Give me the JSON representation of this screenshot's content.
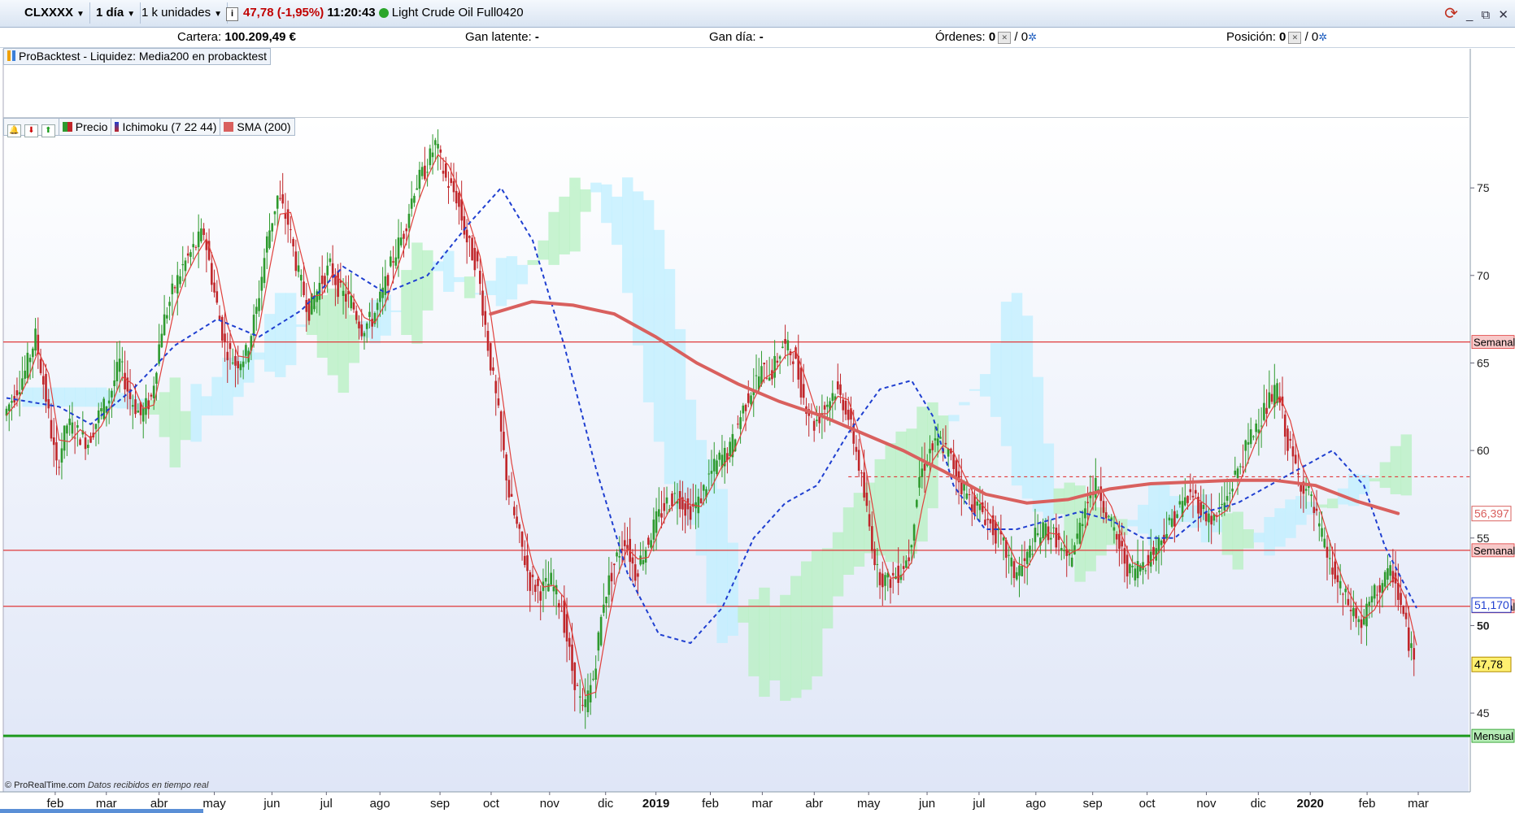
{
  "toolbar": {
    "symbol": "CLXXXX",
    "timeframe": "1 día",
    "units": "1 k unidades",
    "info": "i",
    "price_change": "47,78 (-1,95%)",
    "time": "11:20:43",
    "instrument": "Light Crude Oil Full0420",
    "window_minimize": "_",
    "window_restore": "⧉",
    "window_close": "✕"
  },
  "account": {
    "cartera_label": "Cartera:",
    "cartera_value": "100.209,49 €",
    "gan_latente_label": "Gan latente:",
    "gan_latente_value": "-",
    "gan_dia_label": "Gan día:",
    "gan_dia_value": "-",
    "ordenes_label": "Órdenes:",
    "ordenes_a": "0",
    "ordenes_b": "/ 0",
    "posicion_label": "Posición:",
    "posicion_a": "0",
    "posicion_b": "/ 0"
  },
  "probacktest_label": "ProBacktest - Liquidez: Media200 en probacktest",
  "legend": {
    "precio": "Precio",
    "ichimoku": "Ichimoku (7 22 44)",
    "sma": "SMA (200)"
  },
  "footer": {
    "brand": "© ProRealTime.com",
    "note": "Datos recibidos en tiempo real"
  },
  "colors": {
    "up": "#2e9a2e",
    "down": "#c0262a",
    "sma": "#d9605e",
    "kijun": "#1f3fd0",
    "tenkan": "#e0403c",
    "cloud_blue": "#bfefff",
    "cloud_green": "#b5f0c0",
    "hline_red": "#e03a3a",
    "hline_green": "#1e9a1e",
    "price_tag": "#fff070"
  },
  "chart_data": {
    "type": "candlestick",
    "instrument": "Light Crude Oil Full0420",
    "ylim": [
      40.5,
      79
    ],
    "y_ticks": [
      45,
      50,
      55,
      60,
      65,
      70,
      75
    ],
    "x_ticks": [
      "feb",
      "mar",
      "abr",
      "may",
      "jun",
      "jul",
      "ago",
      "sep",
      "oct",
      "nov",
      "dic",
      "2019",
      "feb",
      "mar",
      "abr",
      "may",
      "jun",
      "jul",
      "ago",
      "sep",
      "oct",
      "nov",
      "dic",
      "2020",
      "feb",
      "mar"
    ],
    "x_ticks_bold": [
      false,
      false,
      false,
      false,
      false,
      false,
      false,
      false,
      false,
      false,
      false,
      true,
      false,
      false,
      false,
      false,
      false,
      false,
      false,
      false,
      false,
      false,
      false,
      true,
      false,
      false
    ],
    "price_path": [
      [
        0,
        62
      ],
      [
        2,
        64.5
      ],
      [
        3,
        66.5
      ],
      [
        4,
        63
      ],
      [
        5,
        59
      ],
      [
        6,
        61.5
      ],
      [
        7,
        61
      ],
      [
        8,
        60.5
      ],
      [
        9,
        62
      ],
      [
        10,
        63
      ],
      [
        11,
        65
      ],
      [
        12,
        63
      ],
      [
        13,
        62
      ],
      [
        14,
        63
      ],
      [
        15,
        67
      ],
      [
        16,
        69
      ],
      [
        17,
        70.5
      ],
      [
        18,
        71.5
      ],
      [
        19,
        72.5
      ],
      [
        20,
        69
      ],
      [
        21,
        66
      ],
      [
        22,
        65
      ],
      [
        23,
        65.5
      ],
      [
        24,
        68
      ],
      [
        25,
        72
      ],
      [
        26,
        74.5
      ],
      [
        27,
        73
      ],
      [
        28,
        70
      ],
      [
        29,
        68
      ],
      [
        30,
        69.5
      ],
      [
        31,
        70.5
      ],
      [
        32,
        69
      ],
      [
        33,
        68.5
      ],
      [
        34,
        67
      ],
      [
        35,
        67.5
      ],
      [
        36,
        69
      ],
      [
        37,
        71
      ],
      [
        38,
        72.5
      ],
      [
        39,
        75
      ],
      [
        40,
        76
      ],
      [
        41,
        77.5
      ],
      [
        42,
        75.5
      ],
      [
        43,
        74.5
      ],
      [
        44,
        72
      ],
      [
        45,
        70.5
      ],
      [
        46,
        66
      ],
      [
        47,
        62
      ],
      [
        48,
        57.5
      ],
      [
        49,
        55
      ],
      [
        50,
        52.5
      ],
      [
        51,
        52
      ],
      [
        52,
        52.5
      ],
      [
        53,
        51
      ],
      [
        54,
        47.5
      ],
      [
        55,
        45
      ],
      [
        56,
        47
      ],
      [
        57,
        51.5
      ],
      [
        58,
        53.5
      ],
      [
        59,
        55
      ],
      [
        60,
        53
      ],
      [
        61,
        54.5
      ],
      [
        62,
        56
      ],
      [
        63,
        57
      ],
      [
        64,
        57.5
      ],
      [
        65,
        56.5
      ],
      [
        66,
        57
      ],
      [
        67,
        58.5
      ],
      [
        68,
        59.5
      ],
      [
        69,
        60
      ],
      [
        70,
        62
      ],
      [
        71,
        63.5
      ],
      [
        72,
        64.5
      ],
      [
        73,
        64.5
      ],
      [
        74,
        66
      ],
      [
        75,
        65.5
      ],
      [
        76,
        63
      ],
      [
        77,
        61.5
      ],
      [
        78,
        62.5
      ],
      [
        79,
        63.5
      ],
      [
        80,
        62.5
      ],
      [
        81,
        60
      ],
      [
        82,
        56.5
      ],
      [
        83,
        53
      ],
      [
        84,
        52.5
      ],
      [
        85,
        53
      ],
      [
        86,
        54
      ],
      [
        87,
        58.5
      ],
      [
        88,
        60
      ],
      [
        89,
        60.5
      ],
      [
        90,
        59.5
      ],
      [
        91,
        58
      ],
      [
        92,
        57
      ],
      [
        93,
        56.5
      ],
      [
        94,
        55.5
      ],
      [
        95,
        54.5
      ],
      [
        96,
        53
      ],
      [
        97,
        53.5
      ],
      [
        98,
        55
      ],
      [
        99,
        55.5
      ],
      [
        100,
        55
      ],
      [
        101,
        53.5
      ],
      [
        102,
        55
      ],
      [
        103,
        57.5
      ],
      [
        104,
        58
      ],
      [
        105,
        56
      ],
      [
        106,
        54.5
      ],
      [
        107,
        53
      ],
      [
        108,
        53.5
      ],
      [
        109,
        54
      ],
      [
        110,
        55
      ],
      [
        111,
        56
      ],
      [
        112,
        57
      ],
      [
        113,
        57.5
      ],
      [
        114,
        56.5
      ],
      [
        115,
        56
      ],
      [
        116,
        57
      ],
      [
        117,
        58.5
      ],
      [
        118,
        60
      ],
      [
        119,
        61.5
      ],
      [
        120,
        62.5
      ],
      [
        121,
        63.5
      ],
      [
        122,
        60.5
      ],
      [
        123,
        58.5
      ],
      [
        124,
        57.5
      ],
      [
        125,
        55.5
      ],
      [
        126,
        53.5
      ],
      [
        127,
        52
      ],
      [
        128,
        51
      ],
      [
        129,
        50
      ],
      [
        130,
        51.5
      ],
      [
        131,
        52.5
      ],
      [
        132,
        53
      ],
      [
        133,
        50.5
      ],
      [
        134,
        47.8
      ]
    ],
    "sma200": [
      [
        0,
        67.8
      ],
      [
        5,
        68.5
      ],
      [
        10,
        68.3
      ],
      [
        15,
        67.8
      ],
      [
        20,
        66.5
      ],
      [
        25,
        65
      ],
      [
        30,
        63.8
      ],
      [
        35,
        62.8
      ],
      [
        40,
        62
      ],
      [
        45,
        61
      ],
      [
        50,
        60
      ],
      [
        55,
        58.8
      ],
      [
        60,
        57.5
      ],
      [
        65,
        57
      ],
      [
        70,
        57.2
      ],
      [
        75,
        57.8
      ],
      [
        80,
        58.1
      ],
      [
        85,
        58.2
      ],
      [
        90,
        58.3
      ],
      [
        95,
        58.3
      ],
      [
        100,
        58
      ],
      [
        105,
        57.1
      ],
      [
        110,
        56.4
      ]
    ],
    "sma200_start_offset": 46,
    "kijun": [
      [
        0,
        63
      ],
      [
        5,
        62.5
      ],
      [
        8,
        61.5
      ],
      [
        12,
        63.5
      ],
      [
        16,
        66
      ],
      [
        20,
        67.5
      ],
      [
        24,
        66.5
      ],
      [
        28,
        68
      ],
      [
        32,
        70.5
      ],
      [
        36,
        69
      ],
      [
        40,
        70
      ],
      [
        44,
        73
      ],
      [
        47,
        75
      ],
      [
        50,
        72
      ],
      [
        53,
        66
      ],
      [
        56,
        59
      ],
      [
        59,
        53
      ],
      [
        62,
        49.5
      ],
      [
        65,
        49
      ],
      [
        68,
        51
      ],
      [
        71,
        55
      ],
      [
        74,
        57
      ],
      [
        77,
        58
      ],
      [
        80,
        61
      ],
      [
        83,
        63.5
      ],
      [
        86,
        64
      ],
      [
        88,
        62
      ],
      [
        90,
        58
      ],
      [
        93,
        55.5
      ],
      [
        96,
        55.5
      ],
      [
        99,
        56
      ],
      [
        102,
        56.5
      ],
      [
        105,
        56
      ],
      [
        108,
        55
      ],
      [
        111,
        55
      ],
      [
        114,
        56.5
      ],
      [
        117,
        57
      ],
      [
        120,
        58
      ],
      [
        123,
        59
      ],
      [
        126,
        60
      ],
      [
        129,
        58
      ],
      [
        131,
        54.5
      ],
      [
        134,
        51
      ]
    ],
    "horizontal_levels": [
      {
        "value": 66.2,
        "label": "Semanal",
        "color": "#e03a3a"
      },
      {
        "value": 54.3,
        "label": "Semanal",
        "color": "#e03a3a"
      },
      {
        "value": 51.1,
        "label": "Semanal",
        "color": "#e03a3a"
      },
      {
        "value": 43.7,
        "label": "Mensual",
        "color": "#1e9a1e"
      }
    ],
    "dashed_level": {
      "value": 58.5,
      "color": "#e03a3a"
    },
    "price_tags": [
      {
        "value": 56.397,
        "label": "56,397",
        "kind": "sma"
      },
      {
        "value": 51.17,
        "label": "51,170",
        "kind": "kijun"
      },
      {
        "value": 47.78,
        "label": "47,78",
        "kind": "last"
      }
    ],
    "last_price": 47.78,
    "change_percent": -1.95
  }
}
